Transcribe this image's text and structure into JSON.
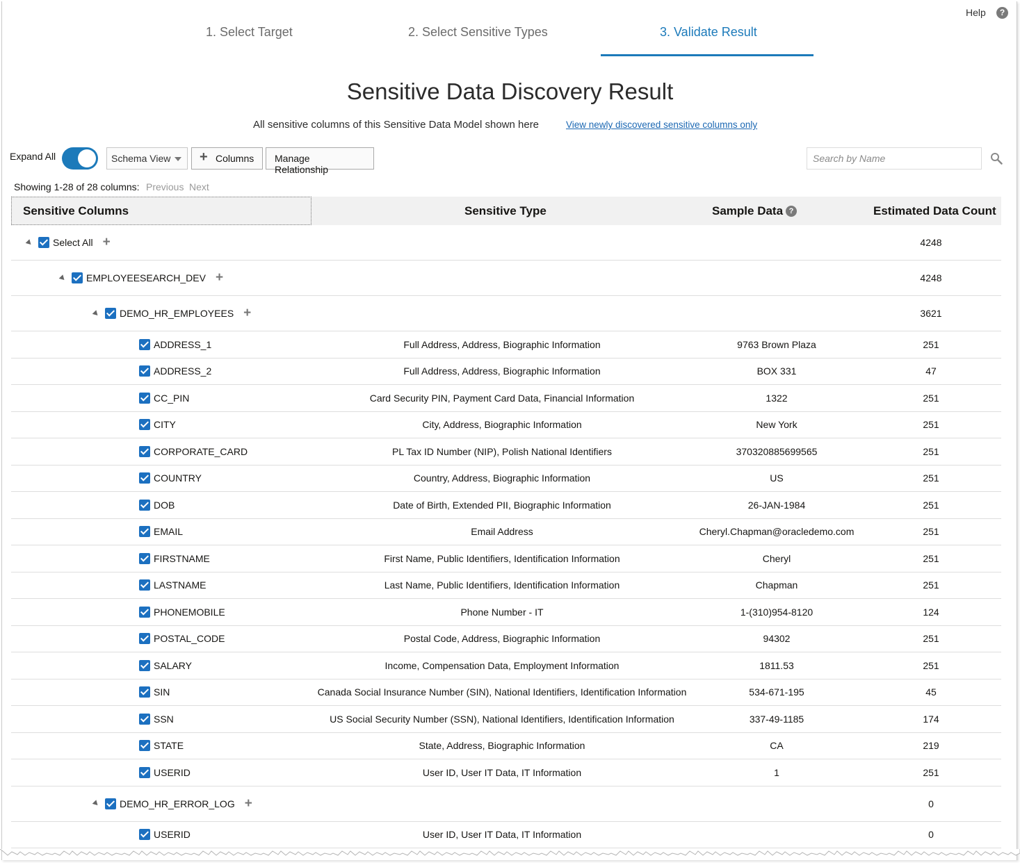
{
  "header": {
    "help_label": "Help",
    "help_icon": "?"
  },
  "steps": [
    {
      "label": "1. Select Target",
      "active": false
    },
    {
      "label": "2. Select Sensitive Types",
      "active": false
    },
    {
      "label": "3. Validate Result",
      "active": true
    }
  ],
  "page": {
    "title": "Sensitive Data Discovery Result",
    "subtitle": "All sensitive columns of this Sensitive Data Model shown here",
    "subtitle_link": "View newly discovered sensitive columns only"
  },
  "toolbar": {
    "expand_all_label": "Expand All",
    "expand_all_on": true,
    "view_select_value": "Schema View",
    "columns_label": "Columns",
    "manage_label": "Manage Relationship",
    "search_placeholder": "Search by Name"
  },
  "pagination": {
    "showing": "Showing 1-28 of 28 columns:",
    "previous": "Previous",
    "next": "Next"
  },
  "table": {
    "headers": {
      "columns": "Sensitive Columns",
      "type": "Sensitive Type",
      "sample": "Sample Data",
      "count": "Estimated Data Count"
    },
    "groups": [
      {
        "name": "Select All",
        "count": "4248"
      },
      {
        "name": "EMPLOYEESEARCH_DEV",
        "count": "4248"
      },
      {
        "name": "DEMO_HR_EMPLOYEES",
        "count": "3621"
      },
      {
        "name": "DEMO_HR_ERROR_LOG",
        "count": "0"
      }
    ],
    "rows": [
      {
        "name": "ADDRESS_1",
        "type": "Full Address, Address, Biographic Information",
        "sample": "9763 Brown Plaza",
        "count": "251"
      },
      {
        "name": "ADDRESS_2",
        "type": "Full Address, Address, Biographic Information",
        "sample": "BOX 331",
        "count": "47"
      },
      {
        "name": "CC_PIN",
        "type": "Card Security PIN, Payment Card Data, Financial Information",
        "sample": "1322",
        "count": "251"
      },
      {
        "name": "CITY",
        "type": "City, Address, Biographic Information",
        "sample": "New York",
        "count": "251"
      },
      {
        "name": "CORPORATE_CARD",
        "type": "PL Tax ID Number (NIP), Polish National Identifiers",
        "sample": "370320885699565",
        "count": "251"
      },
      {
        "name": "COUNTRY",
        "type": "Country, Address, Biographic Information",
        "sample": "US",
        "count": "251"
      },
      {
        "name": "DOB",
        "type": "Date of Birth, Extended PII, Biographic Information",
        "sample": "26-JAN-1984",
        "count": "251"
      },
      {
        "name": "EMAIL",
        "type": "Email Address",
        "sample": "Cheryl.Chapman@oracledemo.com",
        "count": "251"
      },
      {
        "name": "FIRSTNAME",
        "type": "First Name, Public Identifiers, Identification Information",
        "sample": "Cheryl",
        "count": "251"
      },
      {
        "name": "LASTNAME",
        "type": "Last Name, Public Identifiers, Identification Information",
        "sample": "Chapman",
        "count": "251"
      },
      {
        "name": "PHONEMOBILE",
        "type": "Phone Number - IT",
        "sample": "1-(310)954-8120",
        "count": "124"
      },
      {
        "name": "POSTAL_CODE",
        "type": "Postal Code, Address, Biographic Information",
        "sample": "94302",
        "count": "251"
      },
      {
        "name": "SALARY",
        "type": "Income, Compensation Data, Employment Information",
        "sample": "1811.53",
        "count": "251"
      },
      {
        "name": "SIN",
        "type": "Canada Social Insurance Number (SIN), National Identifiers, Identification Information",
        "sample": "534-671-195",
        "count": "45"
      },
      {
        "name": "SSN",
        "type": "US Social Security Number (SSN), National Identifiers, Identification Information",
        "sample": "337-49-1185",
        "count": "174"
      },
      {
        "name": "STATE",
        "type": "State, Address, Biographic Information",
        "sample": "CA",
        "count": "219"
      },
      {
        "name": "USERID",
        "type": "User ID, User IT Data, IT Information",
        "sample": "1",
        "count": "251"
      }
    ],
    "error_log_rows": [
      {
        "name": "USERID",
        "type": "User ID, User IT Data, IT Information",
        "sample": "",
        "count": "0"
      }
    ]
  },
  "colors": {
    "accent": "#1c7aba",
    "checkbox": "#1c70c0",
    "link": "#1c68b3"
  }
}
